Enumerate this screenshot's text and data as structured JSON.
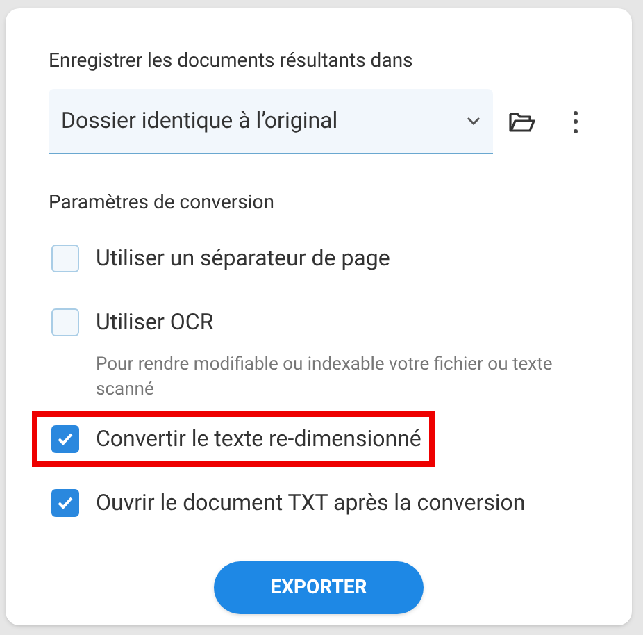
{
  "destination": {
    "label": "Enregistrer les documents résultants dans",
    "value": "Dossier identique à l’original"
  },
  "conversion": {
    "heading": "Paramètres de conversion",
    "options": [
      {
        "label": "Utiliser un séparateur de page",
        "checked": false,
        "highlighted": false
      },
      {
        "label": "Utiliser OCR",
        "checked": false,
        "highlighted": false,
        "hint": "Pour rendre modifiable ou indexable votre fichier ou texte scanné"
      },
      {
        "label": "Convertir le texte re-dimensionné",
        "checked": true,
        "highlighted": true
      },
      {
        "label": "Ouvrir le document TXT après la conversion",
        "checked": true,
        "highlighted": false
      }
    ]
  },
  "export_button": "EXPORTER"
}
